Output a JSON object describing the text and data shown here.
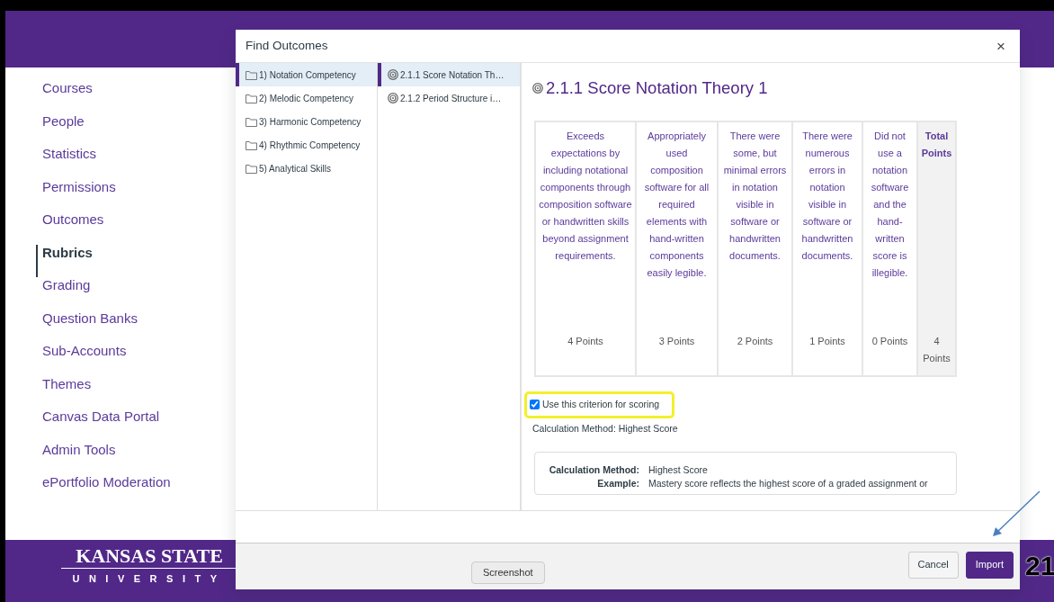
{
  "sidebar": {
    "items": [
      {
        "label": "Courses",
        "selected": false
      },
      {
        "label": "People",
        "selected": false
      },
      {
        "label": "Statistics",
        "selected": false
      },
      {
        "label": "Permissions",
        "selected": false
      },
      {
        "label": "Outcomes",
        "selected": false
      },
      {
        "label": "Rubrics",
        "selected": true
      },
      {
        "label": "Grading",
        "selected": false
      },
      {
        "label": "Question Banks",
        "selected": false
      },
      {
        "label": "Sub-Accounts",
        "selected": false
      },
      {
        "label": "Themes",
        "selected": false
      },
      {
        "label": "Canvas Data Portal",
        "selected": false
      },
      {
        "label": "Admin Tools",
        "selected": false
      },
      {
        "label": "ePortfolio Moderation",
        "selected": false
      }
    ]
  },
  "logo": {
    "line_1": "KANSAS STATE",
    "line_2": "UNIVERSITY"
  },
  "modal": {
    "title": "Find Outcomes",
    "close": "×",
    "groups": [
      {
        "label": "1) Notation Competency",
        "selected": true
      },
      {
        "label": "2) Melodic Competency",
        "selected": false
      },
      {
        "label": "3) Harmonic Competency",
        "selected": false
      },
      {
        "label": "4) Rhythmic Competency",
        "selected": false
      },
      {
        "label": "5) Analytical Skills",
        "selected": false
      }
    ],
    "outcomes": [
      {
        "label": "2.1.1 Score Notation Th…",
        "selected": true
      },
      {
        "label": "2.1.2 Period Structure i…",
        "selected": false
      }
    ],
    "detail": {
      "title": "2.1.1 Score Notation Theory 1",
      "ratings": [
        {
          "description": "Exceeds expectations by including notational components through composition software or handwritten skills beyond assignment requirements.",
          "points": "4 Points"
        },
        {
          "description": "Appropriately used composition software for all required elements with hand-written components easily legible.",
          "points": "3 Points"
        },
        {
          "description": "There were some, but minimal errors in notation visible in software or handwritten documents.",
          "points": "2 Points"
        },
        {
          "description": "There were numerous errors in notation visible in software or handwritten documents.",
          "points": "1 Points"
        },
        {
          "description": "Did not use a notation software and the hand-written score is illegible.",
          "points": "0 Points"
        }
      ],
      "total": {
        "label": "Total Points",
        "value": "4 Points"
      },
      "criterion": {
        "label": "Use this criterion for scoring",
        "checked": true
      },
      "calculation": "Calculation Method: Highest Score",
      "calculation_details": [
        {
          "label": "Calculation Method:",
          "value": "Highest Score"
        },
        {
          "label": "Example:",
          "value": "Mastery score reflects the highest score of a graded assignment or"
        }
      ]
    },
    "buttons": [
      {
        "label": "Cancel",
        "kind": "secondary"
      },
      {
        "label": "Import",
        "kind": "primary"
      }
    ]
  },
  "tooltip": "Screenshot",
  "slide_number": "21"
}
